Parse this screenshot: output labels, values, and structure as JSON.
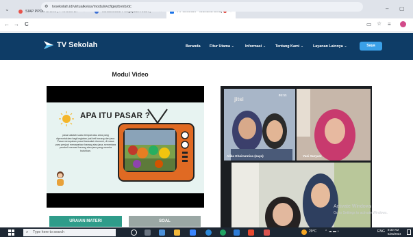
{
  "browser": {
    "tabs": [
      {
        "label": "SIAP PPDB Online | Provinsi DI",
        "close": "×"
      },
      {
        "label": "Tanda Bukti Pengajuan Akun |",
        "close": "×"
      },
      {
        "label": "TV Sekolah - Wahana Belaj",
        "close": "×"
      }
    ],
    "new_tab": "+",
    "url": "tvsekolah.id/virtualkelas/modul/wcfigejrbvnb/dc",
    "window_min": "–",
    "window_max": "▢",
    "nav_back": "←",
    "nav_forward": "→",
    "nav_reload": "C"
  },
  "site": {
    "brand": "TV Sekolah",
    "nav": [
      "Beranda",
      "Fitur Utama ⌄",
      "Informasi ⌄",
      "Tentang Kami ⌄",
      "Layanan Lainnya ⌄"
    ],
    "cta": "Saya"
  },
  "main": {
    "heading": "Modul Video",
    "slide_title": "APA ITU PASAR ?",
    "slide_body": "pasar adalah suatu tempat atau area yang diperuntukkan bagi kegiatan jual-beli barang dan jasa. Pasar merupakan pusat transaksi ekonomi, di mana para penjual menawarkan barang atau jasa, sementara pembeli mencari barang atau jasa yang mereka butuhkan.",
    "tabs": [
      "URAIAN MATERI",
      "SOAL"
    ]
  },
  "call": {
    "jitsi": "jitsi",
    "participants": [
      "Alika Khoirunnisa (saya)",
      "Yani Suryani"
    ],
    "timer": "01:11"
  },
  "watermark": {
    "line1": "Activate Windows",
    "line2": "Go to Settings to activate Windows."
  },
  "taskbar": {
    "search_placeholder": "Type here to search",
    "weather": "29°C",
    "lang": "ENG",
    "time": "9:30 AM",
    "date": "6/23/2024"
  },
  "colors": {
    "nav_bg": "#0e3c66",
    "accent": "#3aa0e8",
    "tab_uraian": "#2f9c8a",
    "tab_soal": "#9aa7a4"
  }
}
